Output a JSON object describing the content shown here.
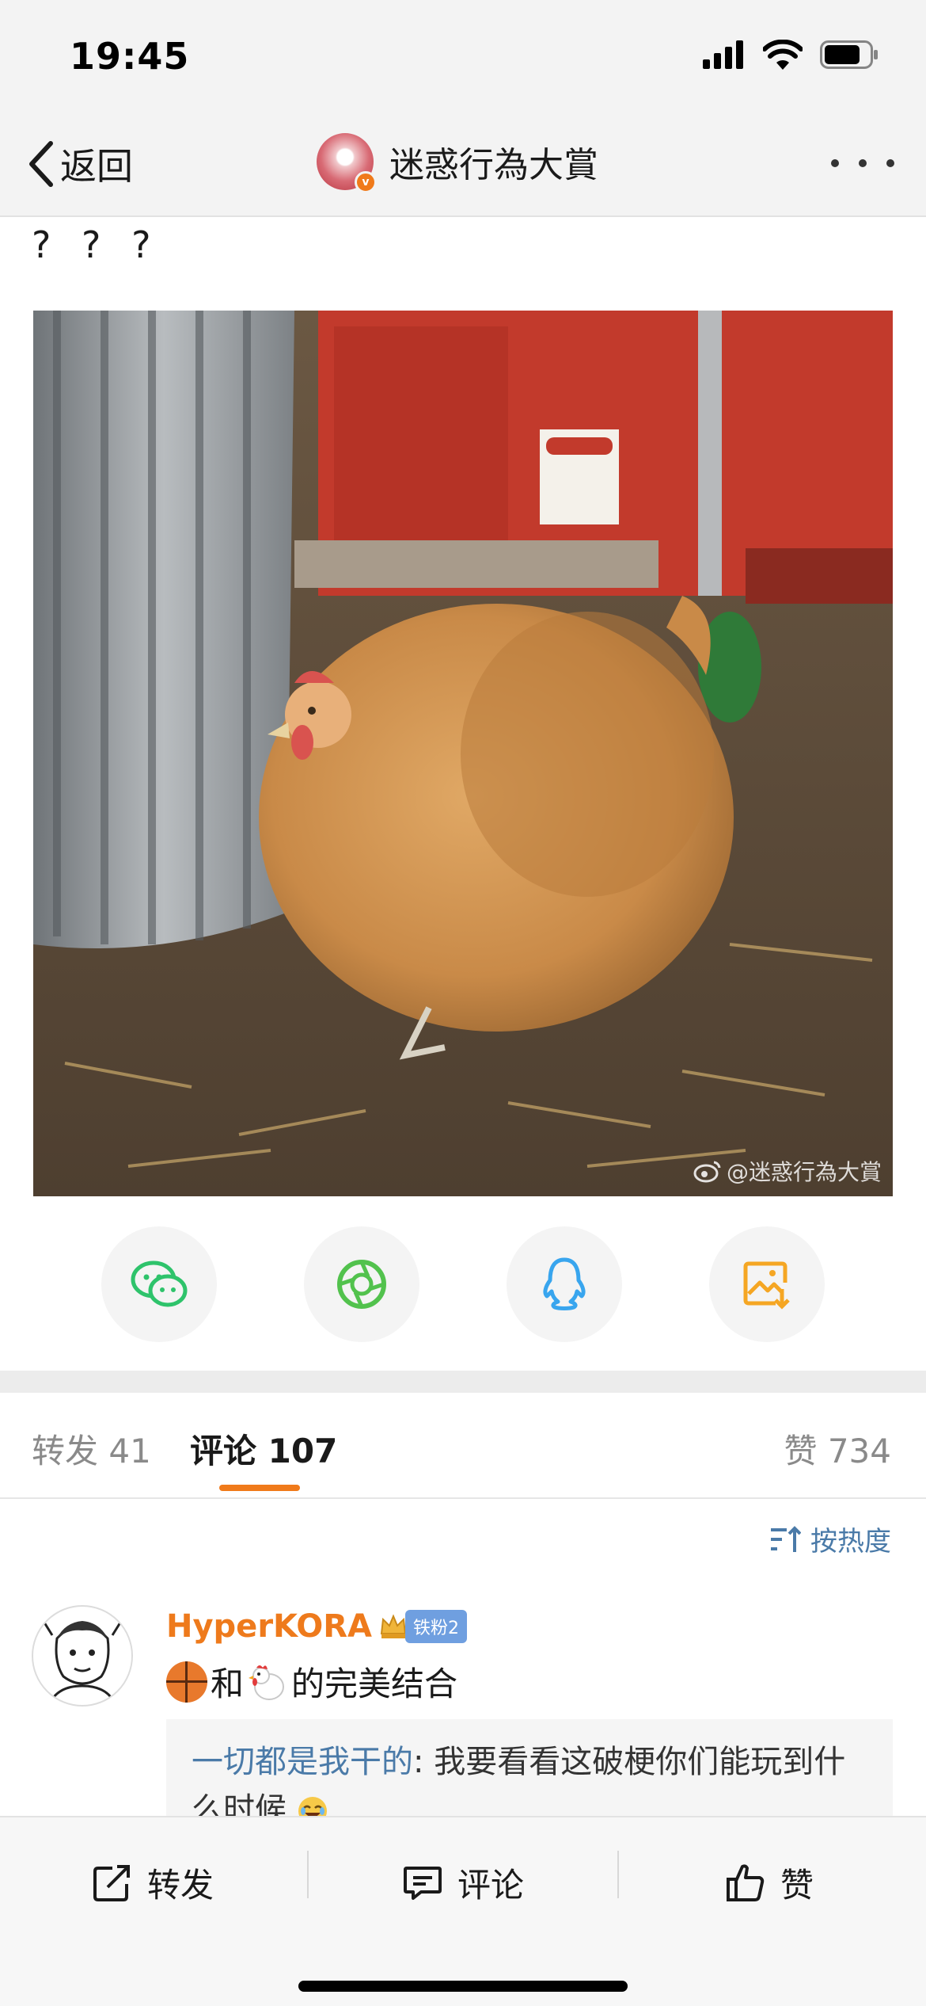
{
  "status_bar": {
    "time": "19:45"
  },
  "nav": {
    "back_label": "返回",
    "title": "迷惑行為大賞"
  },
  "post": {
    "text": "? ? ?",
    "watermark": "@迷惑行為大賞"
  },
  "share": [
    "wechat-icon",
    "moments-icon",
    "qq-icon",
    "save-image-icon"
  ],
  "tabs": {
    "repost": "转发 41",
    "comment": "评论 107",
    "like": "赞 734"
  },
  "sort": {
    "label": "按热度"
  },
  "comment": {
    "username": "HyperKORA",
    "fan_badge": "铁粉2",
    "text_mid": "和",
    "text_end": "的完美结合",
    "reply_user": "一切都是我干的",
    "reply_sep": ":",
    "reply_text": " 我要看看这破梗你们能玩到什么时候"
  },
  "bottom": {
    "repost": "转发",
    "comment": "评论",
    "like": "赞"
  },
  "colors": {
    "accent": "#f07a1a",
    "link": "#4a7aa8",
    "username": "#ee7a1c"
  }
}
